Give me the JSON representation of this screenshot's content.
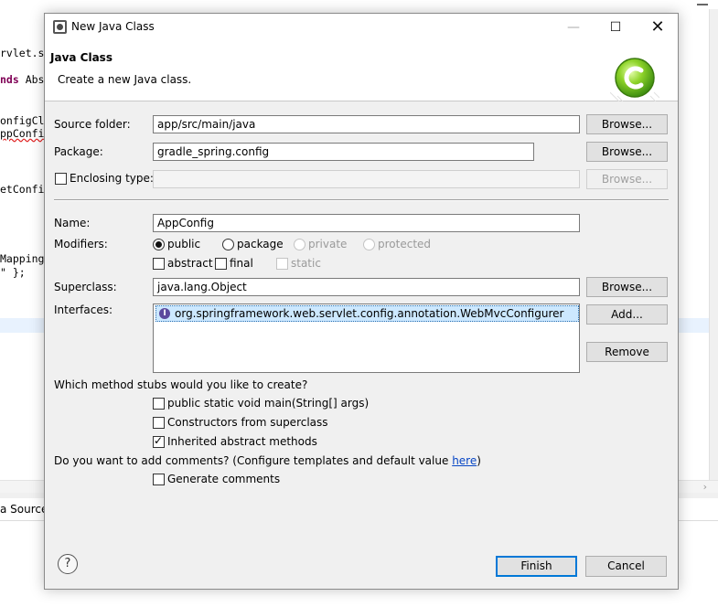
{
  "background": {
    "lines": [
      {
        "text": "rvlet.s",
        "kind": "plain"
      },
      {
        "pre": "nds",
        "text": " Abs",
        "kind": "keyword"
      },
      {
        "text": "onfigCl",
        "kind": "plain"
      },
      {
        "text": "ppConfi",
        "kind": "squiggle"
      },
      {
        "text": "etConfi",
        "kind": "plain"
      },
      {
        "text": "Mapping",
        "kind": "plain"
      },
      {
        "text": "\" };",
        "kind": "plain"
      }
    ],
    "bottom_tab": "a Source",
    "scroll_arrow": "›"
  },
  "dialog": {
    "title": "New Java Class",
    "window_buttons": {
      "minimize": "—",
      "maximize": "☐",
      "close": "✕"
    },
    "header": {
      "title": "Java Class",
      "description": "Create a new Java class."
    },
    "source_folder": {
      "label": "Source folder:",
      "value": "app/src/main/java",
      "browse": "Browse..."
    },
    "package": {
      "label": "Package:",
      "value": "gradle_spring.config",
      "browse": "Browse..."
    },
    "enclosing_type": {
      "label": "Enclosing type:",
      "value": "",
      "checked": false,
      "browse": "Browse..."
    },
    "name": {
      "label": "Name:",
      "value": "AppConfig"
    },
    "modifiers": {
      "label": "Modifiers:",
      "public": "public",
      "package": "package",
      "private": "private",
      "protected": "protected",
      "selected": "public",
      "abstract": "abstract",
      "final": "final",
      "static": "static"
    },
    "superclass": {
      "label": "Superclass:",
      "value": "java.lang.Object",
      "browse": "Browse..."
    },
    "interfaces": {
      "label": "Interfaces:",
      "items": [
        "org.springframework.web.servlet.config.annotation.WebMvcConfigurer"
      ],
      "add": "Add...",
      "remove": "Remove"
    },
    "stubs": {
      "question": "Which method stubs would you like to create?",
      "main": {
        "label": "public static void main(String[] args)",
        "checked": false
      },
      "constructors": {
        "label": "Constructors from superclass",
        "checked": false
      },
      "inherited": {
        "label": "Inherited abstract methods",
        "checked": true
      }
    },
    "comments": {
      "question_prefix": "Do you want to add comments? (Configure templates and default value ",
      "link": "here",
      "question_suffix": ")",
      "generate": {
        "label": "Generate comments",
        "checked": false
      }
    },
    "footer": {
      "help": "?",
      "finish": "Finish",
      "cancel": "Cancel"
    }
  },
  "colors": {
    "accent": "#0078d7",
    "selection": "#cce8ff",
    "link": "#0645c5",
    "eclipse_green": "#6cbf1f"
  }
}
